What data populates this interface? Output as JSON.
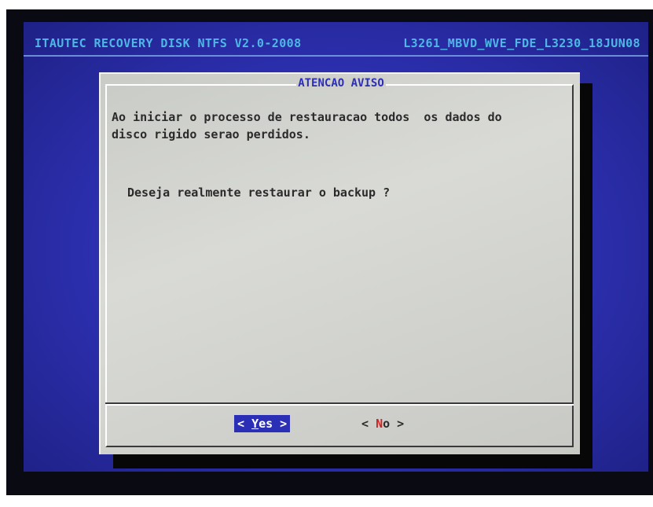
{
  "topbar": {
    "left_text": "ITAUTEC RECOVERY DISK NTFS V2.0-2008",
    "right_text": "L3261_MBVD_WVE_FDE_L3230_18JUN08"
  },
  "dialog": {
    "title": "ATENCAO AVISO",
    "message": "Ao iniciar o processo de restauracao todos  os dados do\ndisco rigido serao perdidos.",
    "question": "Deseja realmente restaurar o backup ?",
    "buttons": {
      "yes": {
        "open": "< ",
        "hotkey": "Y",
        "rest": "es",
        "close": " >"
      },
      "no": {
        "open": "< ",
        "hotkey": "N",
        "rest": "o",
        "close": "  >"
      }
    }
  },
  "colors": {
    "screen_background": "#2c2fae",
    "topbar_text": "#4fb6e6",
    "dialog_background": "#d0d1cc",
    "selected_button": "#2b2fb5",
    "hotkey_no": "#d42222"
  }
}
